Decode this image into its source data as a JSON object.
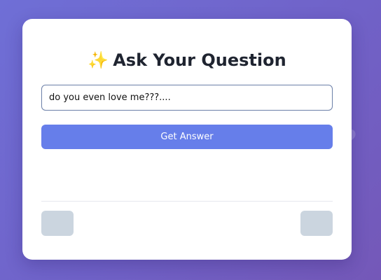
{
  "card": {
    "title_icon": "✨",
    "title": "Ask Your Question"
  },
  "form": {
    "question_value": "do you even love me???....",
    "submit_label": "Get Answer"
  },
  "background": {
    "glyph": "?"
  },
  "colors": {
    "accent": "#667eea",
    "nav_button": "#cbd5df",
    "title_text": "#1f2430"
  }
}
